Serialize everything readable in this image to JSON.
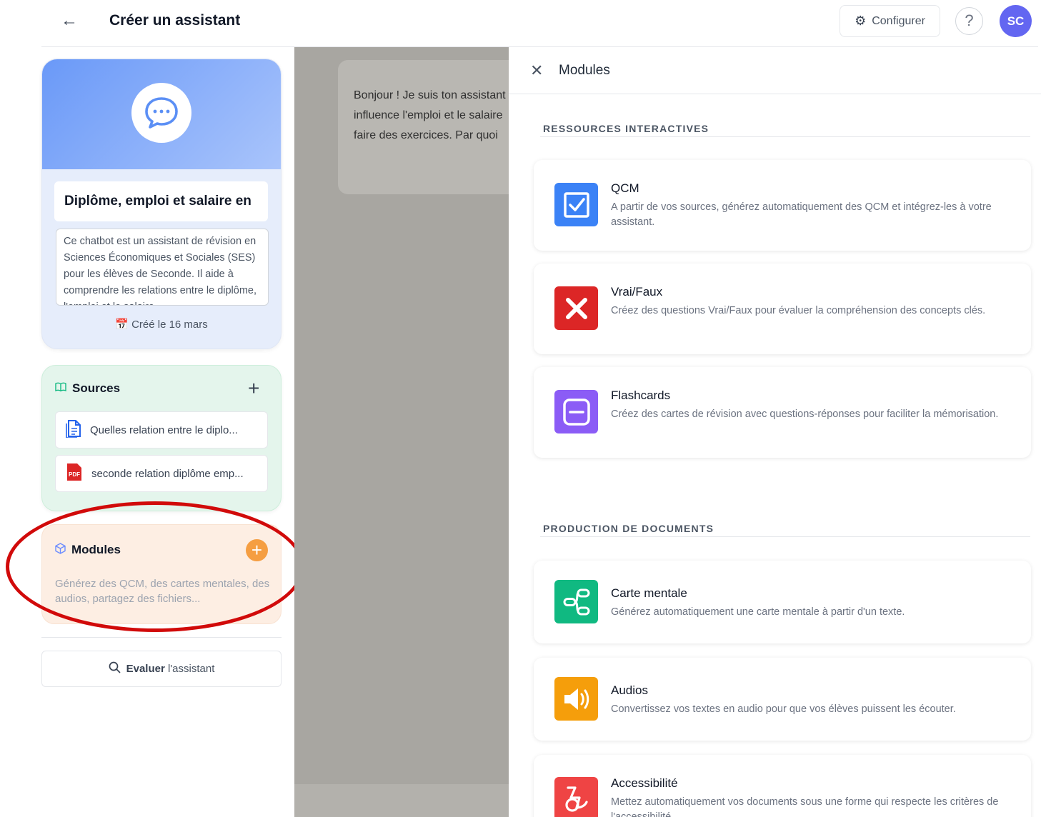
{
  "header": {
    "title": "Créer un assistant",
    "configure_label": "Configurer",
    "help_label": "?",
    "avatar_initials": "SC"
  },
  "assistant": {
    "name": "Diplôme, emploi et salaire en",
    "description": "Ce chatbot est un assistant de révision en Sciences Économiques et Sociales (SES) pour les élèves de Seconde. Il aide à comprendre les relations entre le diplôme, l'emploi et le salaire",
    "created": "Créé le 16 mars"
  },
  "sources": {
    "title": "Sources",
    "items": [
      {
        "label": "Quelles relation entre le diplo...",
        "icon": "document-icon"
      },
      {
        "label": "seconde relation diplôme emp...",
        "icon": "pdf-icon"
      }
    ]
  },
  "modules_card": {
    "title": "Modules",
    "description": "Générez des QCM, des cartes mentales, des audios, partagez des fichiers..."
  },
  "evaluate": {
    "bold": "Evaluer",
    "rest": "l'assistant"
  },
  "chat": {
    "lines": [
      "Bonjour ! Je suis ton assistant",
      "influence l'emploi et le salaire",
      "faire des exercices. Par quoi"
    ]
  },
  "panel": {
    "title": "Modules",
    "sections": [
      {
        "title": "RESSOURCES INTERACTIVES",
        "modules": [
          {
            "title": "QCM",
            "description": "A partir de vos sources, générez automatiquement des QCM et intégrez-les à votre assistant.",
            "color": "#3b82f6"
          },
          {
            "title": "Vrai/Faux",
            "description": "Créez des questions Vrai/Faux pour évaluer la compréhension des concepts clés.",
            "color": "#dc2626"
          },
          {
            "title": "Flashcards",
            "description": "Créez des cartes de révision avec questions-réponses pour faciliter la mémorisation.",
            "color": "#8b5cf6"
          }
        ]
      },
      {
        "title": "PRODUCTION DE DOCUMENTS",
        "modules": [
          {
            "title": "Carte mentale",
            "description": "Générez automatiquement une carte mentale à partir d'un texte.",
            "color": "#10b981"
          },
          {
            "title": "Audios",
            "description": "Convertissez vos textes en audio pour que vos élèves puissent les écouter.",
            "color": "#f59e0b"
          },
          {
            "title": "Accessibilité",
            "description": "Mettez automatiquement vos documents sous une forme qui respecte les critères de l'accessibilité.",
            "color": "#ef4444"
          }
        ]
      }
    ]
  }
}
